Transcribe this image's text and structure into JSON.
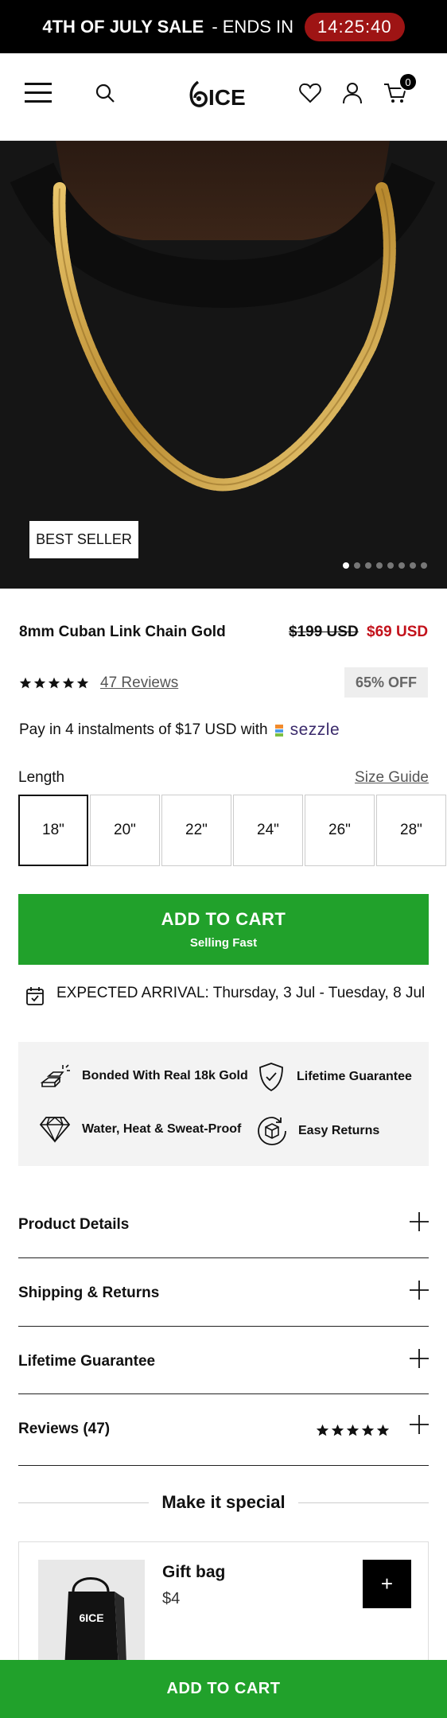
{
  "announcement": {
    "bold_text": "4TH OF JULY SALE",
    "text": "- ENDS IN",
    "timer": "14:25:40"
  },
  "header": {
    "logo_text": "6ICE",
    "cart_count": "0"
  },
  "hero": {
    "badge": "BEST SELLER",
    "slide_count": 8,
    "active_slide": 1
  },
  "product": {
    "title": "8mm Cuban Link Chain Gold",
    "price_original": "$199 USD",
    "price_sale": "$69 USD",
    "rating": 5,
    "reviews_link": "47 Reviews",
    "discount_badge": "65% OFF",
    "installments_text": "Pay in 4 instalments of $17 USD with",
    "sezzle_label": "sezzle"
  },
  "length": {
    "label": "Length",
    "size_guide": "Size Guide",
    "options": [
      "18\"",
      "20\"",
      "22\"",
      "24\"",
      "26\"",
      "28\""
    ],
    "selected": "18\""
  },
  "add_to_cart": {
    "label": "ADD TO CART",
    "sublabel": "Selling Fast"
  },
  "arrival": {
    "label": "EXPECTED ARRIVAL:",
    "dates": "Thursday, 3 Jul - Tuesday, 8 Jul"
  },
  "features": [
    {
      "icon": "gold-bars-icon",
      "label": "Bonded With Real 18k Gold"
    },
    {
      "icon": "shield-check-icon",
      "label": "Lifetime Guarantee"
    },
    {
      "icon": "diamond-icon",
      "label": "Water, Heat & Sweat-Proof"
    },
    {
      "icon": "return-box-icon",
      "label": "Easy Returns"
    }
  ],
  "accordions": [
    {
      "label": "Product Details"
    },
    {
      "label": "Shipping & Returns"
    },
    {
      "label": "Lifetime Guarantee"
    },
    {
      "label": "Reviews",
      "count": "(47)",
      "rating": 5
    }
  ],
  "upsell": {
    "heading": "Make it special",
    "item_name": "Gift bag",
    "item_price": "$4",
    "add_label": "+",
    "bag_logo": "6ICE"
  },
  "sticky_cta": {
    "label": "ADD TO CART"
  },
  "colors": {
    "accent_green": "#21a12b",
    "sale_red": "#c3121b",
    "timer_red": "#9e1414",
    "gold": "#c9a24a"
  }
}
